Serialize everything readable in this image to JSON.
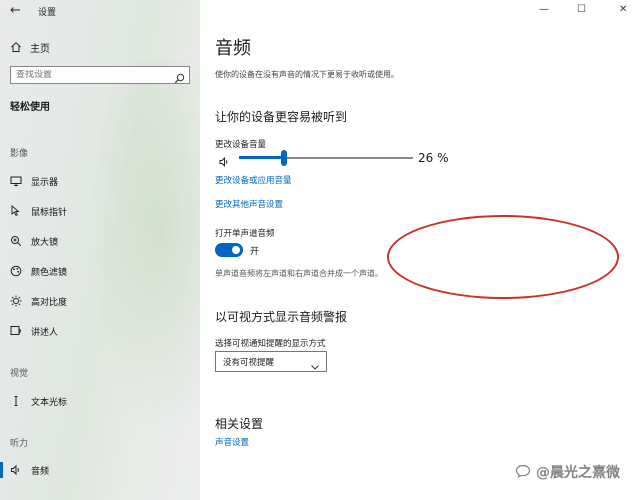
{
  "window": {
    "title": "设置",
    "controls": {
      "minimize": "—",
      "maximize": "☐",
      "close": "✕"
    }
  },
  "sidebar": {
    "home_label": "主页",
    "search_placeholder": "查找设置",
    "section_title": "轻松使用",
    "categories": [
      {
        "label": "影像",
        "items": [
          {
            "label": "显示器",
            "icon": "monitor-icon"
          },
          {
            "label": "鼠标指针",
            "icon": "mouse-pointer-icon"
          },
          {
            "label": "放大镜",
            "icon": "magnifier-icon"
          },
          {
            "label": "颜色滤镜",
            "icon": "color-filter-icon"
          },
          {
            "label": "高对比度",
            "icon": "high-contrast-icon"
          },
          {
            "label": "讲述人",
            "icon": "narrator-icon"
          }
        ]
      },
      {
        "label": "视觉",
        "items": [
          {
            "label": "文本光标",
            "icon": "text-cursor-icon"
          }
        ]
      },
      {
        "label": "听力",
        "items": [
          {
            "label": "音频",
            "icon": "audio-icon",
            "active": true
          }
        ]
      }
    ]
  },
  "main": {
    "title": "音频",
    "description": "使你的设备在没有声音的情况下更易于收听或使用。",
    "section1": {
      "heading": "让你的设备更容易被听到",
      "volume_label": "更改设备音量",
      "volume_value": 26,
      "volume_text": "26 %",
      "link_app_volume": "更改设备或应用音量",
      "link_other_sound": "更改其他声音设置",
      "mono_label": "打开单声道音频",
      "mono_state": "开",
      "mono_on": true,
      "mono_desc": "单声道音频将左声道和右声道合并成一个声道。"
    },
    "section2": {
      "heading": "以可视方式显示音频警报",
      "dropdown_label": "选择可视通知提醒的显示方式",
      "dropdown_value": "没有可视提醒"
    },
    "section3": {
      "heading": "相关设置",
      "link_sound_settings": "声音设置"
    }
  },
  "overlay": {
    "watermark_text": "@晨光之熹微",
    "annotation_color": "#c8322a"
  },
  "colors": {
    "accent": "#0067c0"
  }
}
